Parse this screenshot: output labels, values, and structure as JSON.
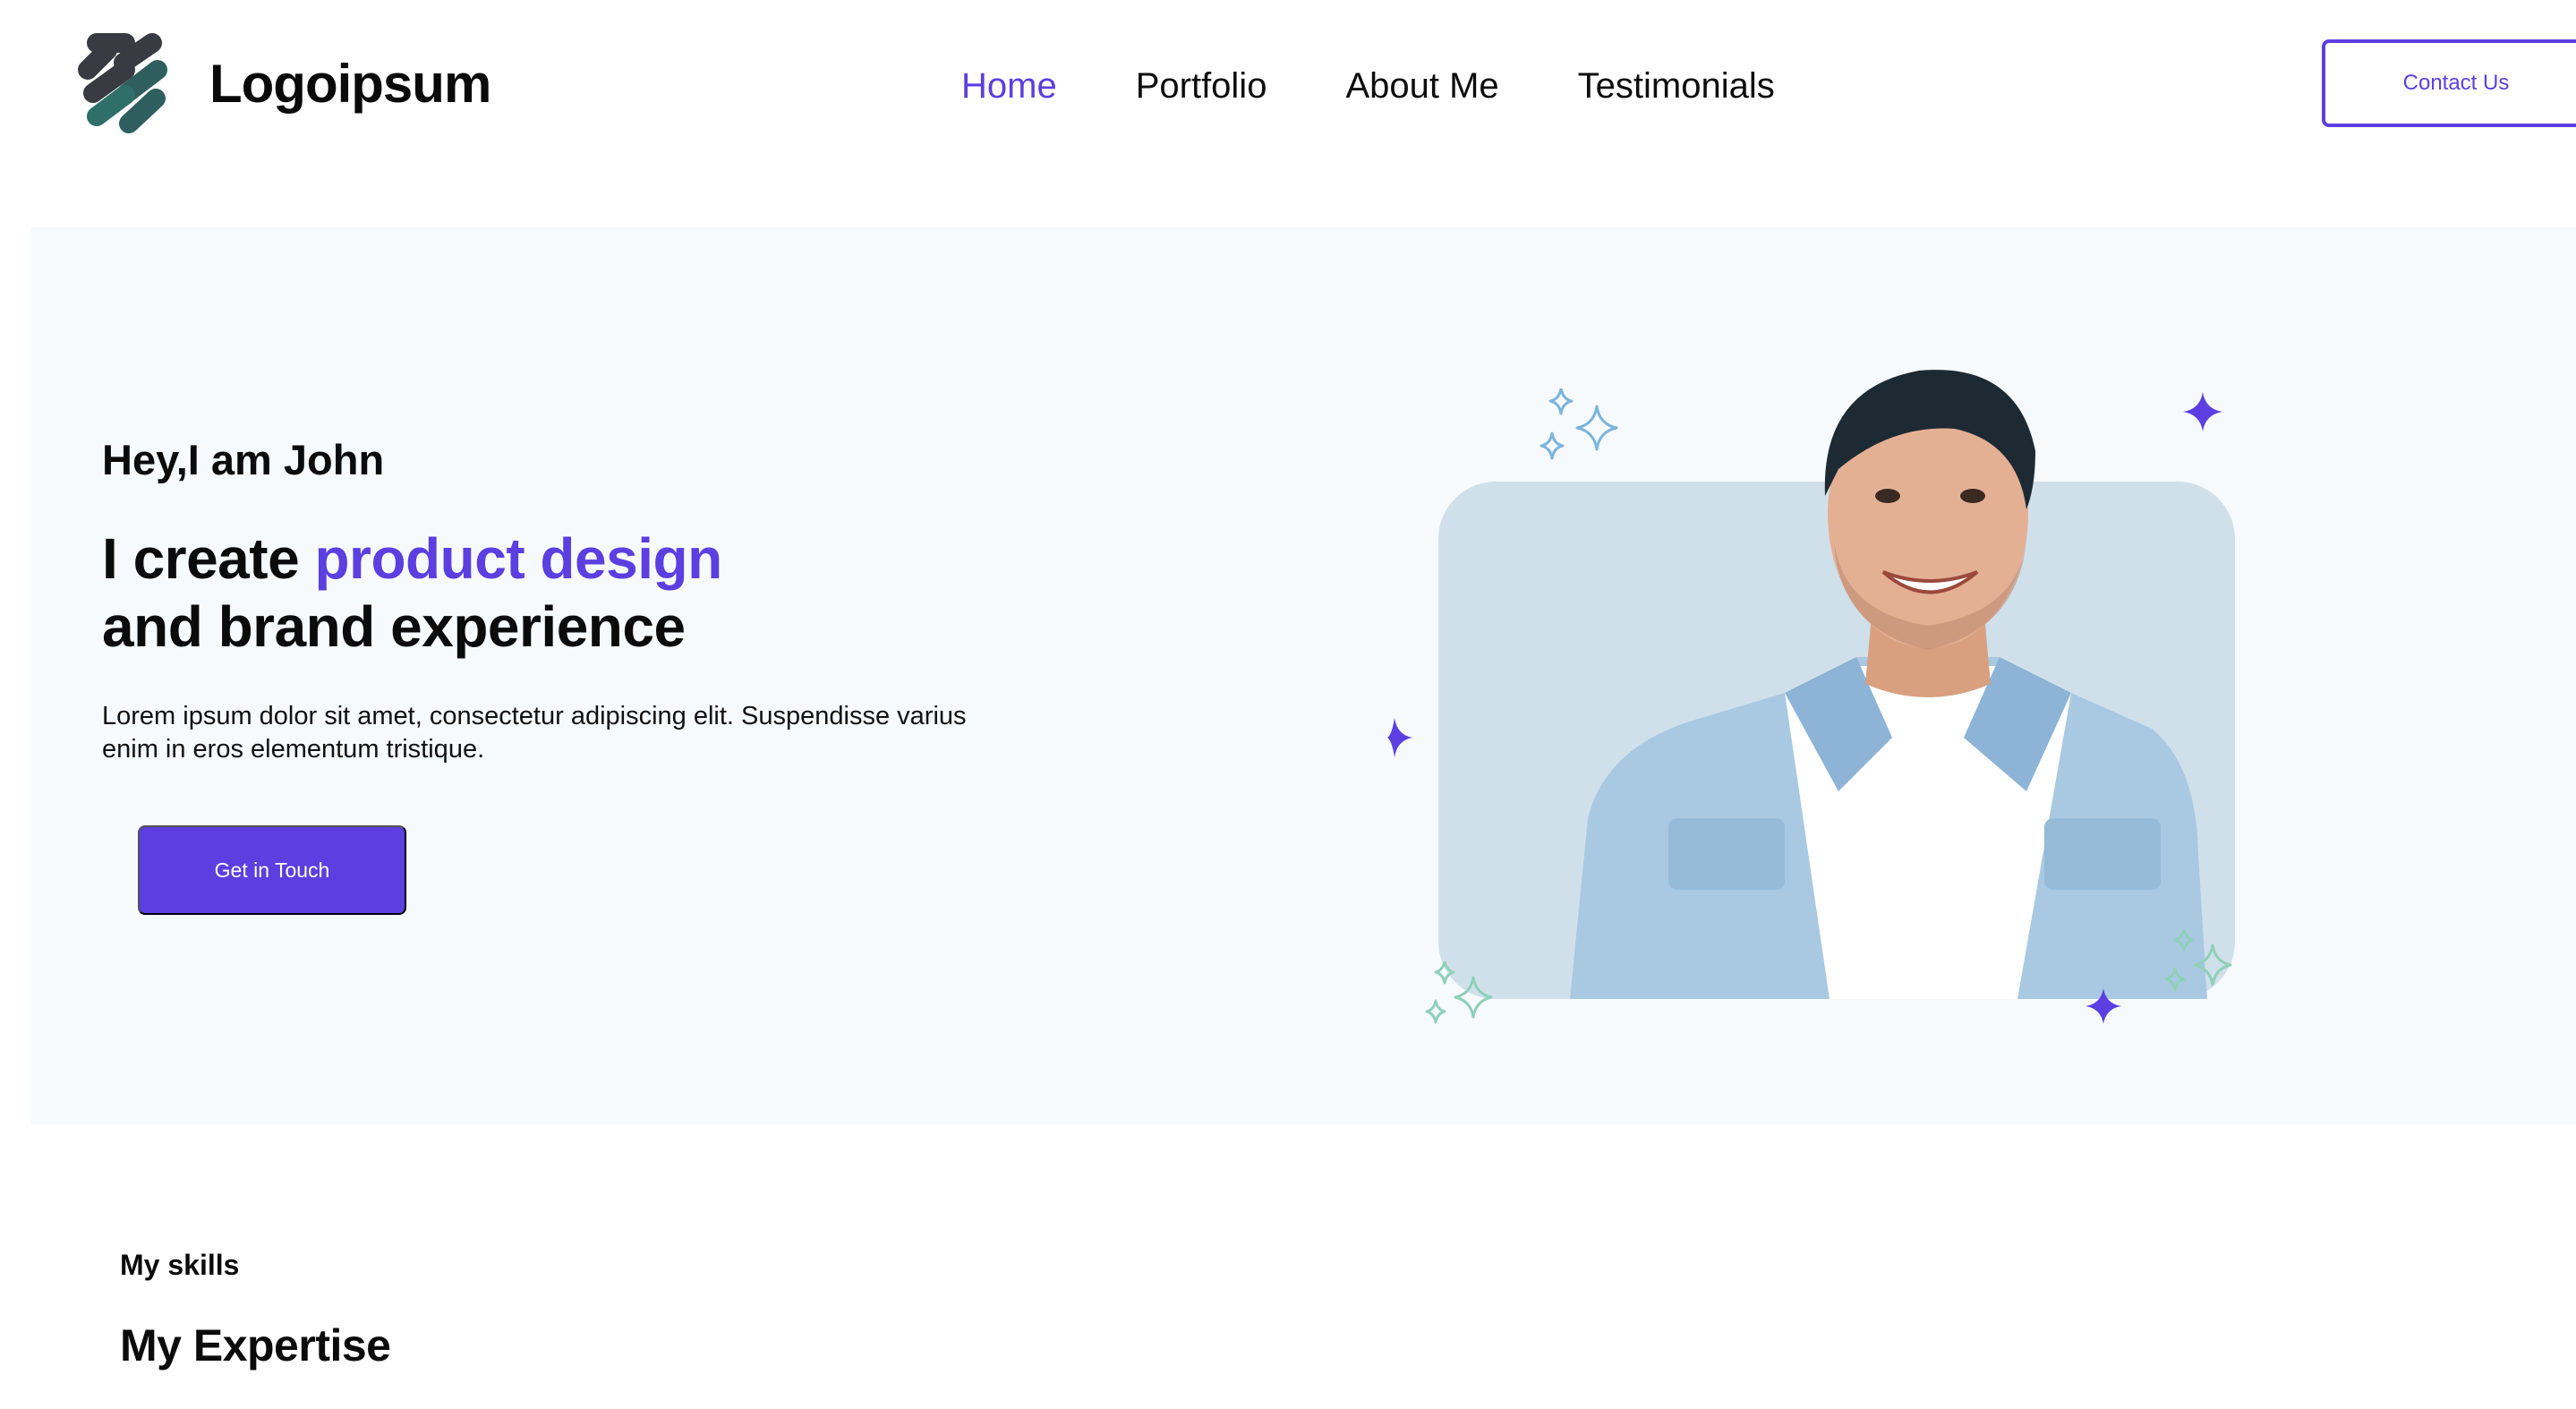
{
  "brand": {
    "name": "Logoipsum",
    "logo_icon": "molecule-logo-icon"
  },
  "nav": {
    "items": [
      {
        "label": "Home",
        "active": true
      },
      {
        "label": "Portfolio",
        "active": false
      },
      {
        "label": "About Me",
        "active": false
      },
      {
        "label": "Testimonials",
        "active": false
      }
    ],
    "contact_label": "Contact Us"
  },
  "hero": {
    "greeting": "Hey,I am John",
    "headline_prefix": "I create ",
    "headline_accent": "product design",
    "headline_line2": "and brand experience",
    "description": "Lorem ipsum dolor sit amet, consectetur adipiscing elit. Suspendisse varius enim in eros elementum tristique.",
    "cta_label": "Get in Touch",
    "image_alt": "smiling-man-in-denim-shirt"
  },
  "skills": {
    "label": "My skills",
    "title": "My Expertise"
  },
  "colors": {
    "accent": "#5b3fe0",
    "hero_bg": "#f6fafd",
    "card_bg": "#d0e0eb",
    "sparkle_blue": "#7cb4dc",
    "sparkle_green": "#8fd0b8"
  }
}
